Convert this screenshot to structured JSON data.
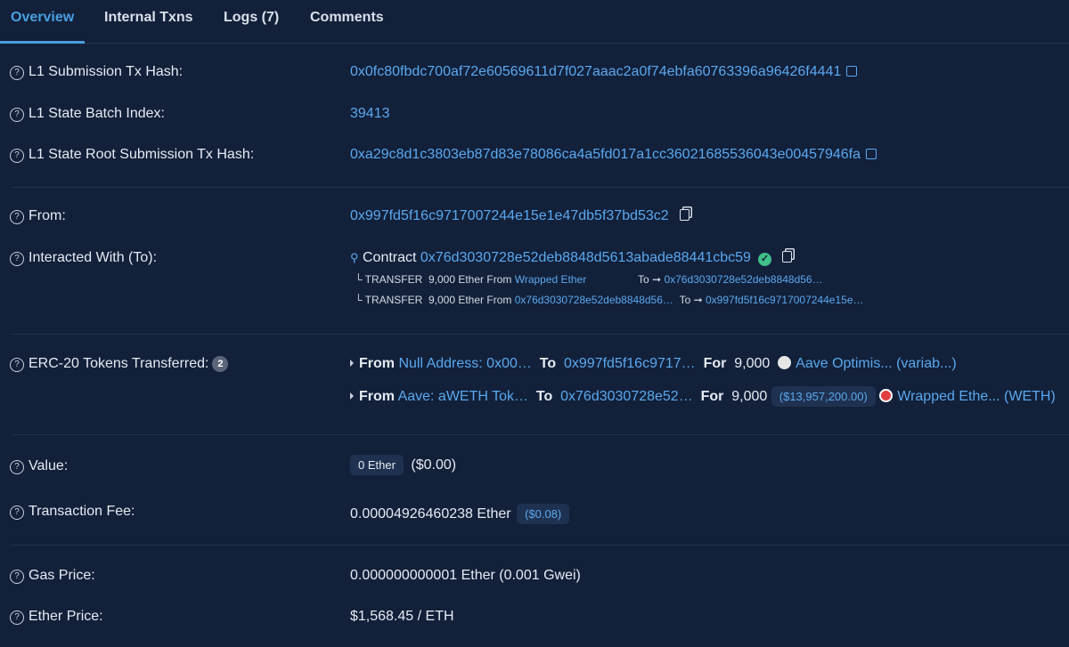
{
  "tabs": [
    "Overview",
    "Internal Txns",
    "Logs (7)",
    "Comments"
  ],
  "fields": {
    "l1_submission": {
      "label": "L1 Submission Tx Hash:",
      "value": "0x0fc80fbdc700af72e60569611d7f027aaac2a0f74ebfa60763396a96426f4441"
    },
    "l1_batch": {
      "label": "L1 State Batch Index:",
      "value": "39413"
    },
    "l1_root": {
      "label": "L1 State Root Submission Tx Hash:",
      "value": "0xa29c8d1c3803eb87d83e78086ca4a5fd017a1cc36021685536043e00457946fa"
    },
    "from": {
      "label": "From:",
      "value": "0x997fd5f16c9717007244e15e1e47db5f37bd53c2"
    },
    "to": {
      "label": "Interacted With (To):",
      "prefix": "Contract",
      "value": "0x76d3030728e52deb8848d5613abade88441cbc59",
      "transfers": [
        {
          "kind": "TRANSFER",
          "amount": "9,000 Ether",
          "from_word": "From",
          "from": "Wrapped Ether",
          "to_word": "To",
          "to": "0x76d3030728e52deb8848d56…"
        },
        {
          "kind": "TRANSFER",
          "amount": "9,000 Ether",
          "from_word": "From",
          "from": "0x76d3030728e52deb8848d56…",
          "to_word": "To",
          "to": "0x997fd5f16c9717007244e15e…"
        }
      ]
    },
    "erc20": {
      "label": "ERC-20 Tokens Transferred:",
      "count": "2",
      "rows": [
        {
          "from_word": "From",
          "from": "Null Address: 0x00…",
          "to_word": "To",
          "to": "0x997fd5f16c9717…",
          "for_word": "For",
          "amount": "9,000",
          "usd": "",
          "token": "Aave Optimis... (variab...)",
          "token_icon_color": "#e6e6e6"
        },
        {
          "from_word": "From",
          "from": "Aave: aWETH Tok…",
          "to_word": "To",
          "to": "0x76d3030728e52…",
          "for_word": "For",
          "amount": "9,000",
          "usd": "($13,957,200.00)",
          "token": "Wrapped Ethe... (WETH)",
          "token_icon_color": "#e04040"
        }
      ]
    },
    "value": {
      "label": "Value:",
      "badge": "0 Ether",
      "usd": "($0.00)"
    },
    "fee": {
      "label": "Transaction Fee:",
      "value": "0.00004926460238 Ether",
      "usd": "($0.08)"
    },
    "gas": {
      "label": "Gas Price:",
      "value": "0.000000000001 Ether (0.001 Gwei)"
    },
    "ether_price": {
      "label": "Ether Price:",
      "value": "$1,568.45 / ETH"
    }
  },
  "icons": [
    "question-icon",
    "external-link-icon",
    "copy-icon",
    "verified-check-icon",
    "contract-search-icon",
    "caret-right-icon"
  ],
  "colors": {
    "background": "#12203a",
    "link": "#5aa8ee",
    "verified": "#3fbf8a"
  }
}
